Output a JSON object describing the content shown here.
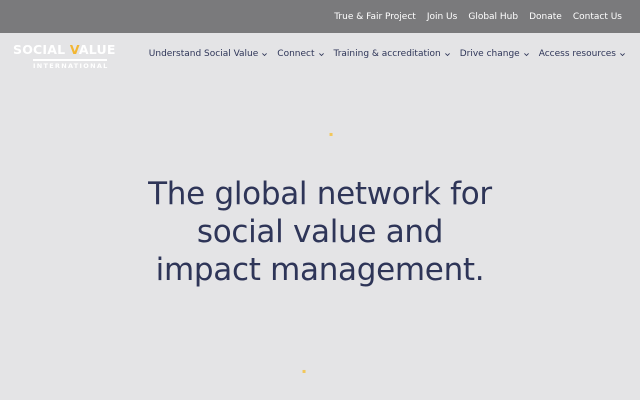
{
  "topbar": {
    "links": [
      "True & Fair Project",
      "Join Us",
      "Global Hub",
      "Donate",
      "Contact Us"
    ]
  },
  "logo": {
    "word1": "SOCIAL ",
    "accent_letter": "V",
    "word2": "ALUE",
    "subtitle": "INTERNATIONAL"
  },
  "nav": {
    "items": [
      "Understand Social Value",
      "Connect",
      "Training & accreditation",
      "Drive change",
      "Access resources"
    ]
  },
  "hero": {
    "line1": "The global network for",
    "line2": "social value and",
    "line3": "impact management."
  },
  "colors": {
    "topbar_bg": "#7a7a7c",
    "page_bg": "#e4e4e6",
    "navy": "#2e3558",
    "accent": "#f2b633"
  }
}
